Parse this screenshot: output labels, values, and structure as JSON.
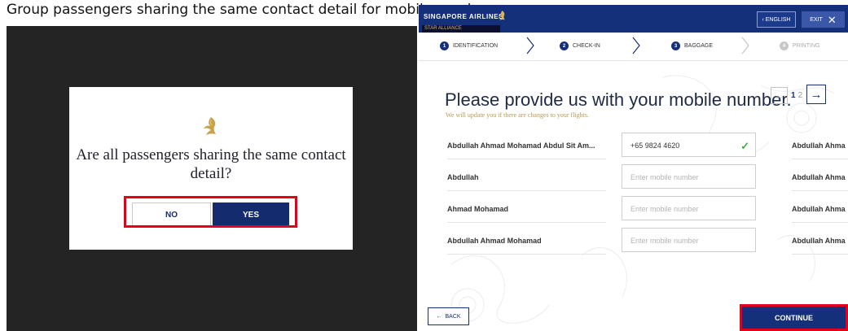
{
  "caption": "Group passengers sharing the same contact detail for mobile number",
  "left_screen": {
    "dialog": {
      "logo_icon": "singapore-airlines-bird-icon",
      "question": "Are all passengers sharing the same contact detail?",
      "no_label": "NO",
      "yes_label": "YES"
    }
  },
  "right_screen": {
    "header": {
      "brand": "SINGAPORE AIRLINES",
      "alliance": "STAR ALLIANCE",
      "english_label": "‹ ENGLISH",
      "exit_label": "EXIT"
    },
    "steps": [
      {
        "num": "1",
        "label": "IDENTIFICATION",
        "state": "active"
      },
      {
        "num": "2",
        "label": "CHECK-IN",
        "state": "active"
      },
      {
        "num": "3",
        "label": "BAGGAGE",
        "state": "active"
      },
      {
        "num": "4",
        "label": "PRINTING",
        "state": "disabled"
      }
    ],
    "heading": "Please provide us with your mobile number.",
    "subheading": "We will update you if there are changes to your flights.",
    "pager": {
      "current": "1",
      "other": "2"
    },
    "passengers": [
      {
        "name": "Abdullah Ahmad Mohamad Abdul  Sit Am...",
        "value": "+65 9824 4620",
        "placeholder": "Enter mobile number",
        "verified": true
      },
      {
        "name": "Abdullah",
        "value": "",
        "placeholder": "Enter mobile number",
        "verified": false
      },
      {
        "name": "Ahmad Mohamad",
        "value": "",
        "placeholder": "Enter mobile number",
        "verified": false
      },
      {
        "name": "Abdullah Ahmad Mohamad",
        "value": "",
        "placeholder": "Enter mobile number",
        "verified": false
      }
    ],
    "next_page_names": [
      "Abdullah Ahma",
      "Abdullah Ahma",
      "Abdullah Ahma",
      "Abdullah Ahma"
    ],
    "back_label": "BACK",
    "continue_label": "CONTINUE"
  },
  "colors": {
    "brand_navy": "#15307a",
    "highlight_red": "#e4001b",
    "gold": "#b99a52",
    "verified_green": "#3fae49",
    "dark_backdrop": "#242424"
  }
}
